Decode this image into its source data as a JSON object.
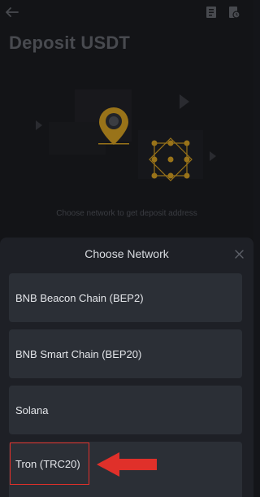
{
  "header": {
    "title": "Deposit USDT",
    "back_icon": "arrow-left-icon",
    "icons": [
      "receipt-icon",
      "history-icon"
    ]
  },
  "illustration": {
    "hint": "Choose network to get deposit address"
  },
  "sheet": {
    "title": "Choose Network",
    "close_icon": "close-icon",
    "networks": [
      {
        "label": "BNB Beacon Chain (BEP2)"
      },
      {
        "label": "BNB Smart Chain (BEP20)"
      },
      {
        "label": "Solana"
      },
      {
        "label": "Tron (TRC20)"
      }
    ]
  },
  "annotation": {
    "highlight_color": "#e0302a",
    "arrow_color": "#e0302a"
  },
  "colors": {
    "accent": "#d6a524",
    "background": "#16171b",
    "sheet": "#1e2026",
    "option": "#2b2f36"
  }
}
